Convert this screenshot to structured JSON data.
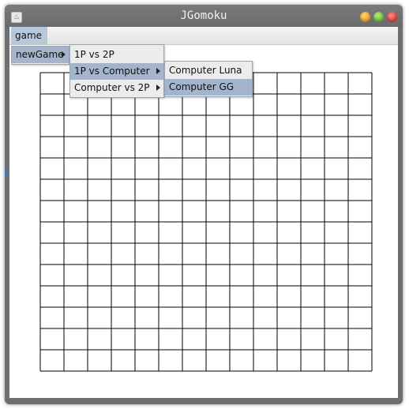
{
  "window": {
    "title": "JGomoku",
    "app_icon_glyph": "♨"
  },
  "menubar": {
    "game_label": "game"
  },
  "game_menu": {
    "items": [
      {
        "label": "newGame",
        "has_submenu": true,
        "selected": true
      }
    ]
  },
  "newgame_menu": {
    "items": [
      {
        "label": "1P vs 2P",
        "has_submenu": false,
        "selected": false
      },
      {
        "label": "1P vs Computer",
        "has_submenu": true,
        "selected": true
      },
      {
        "label": "Computer vs 2P",
        "has_submenu": true,
        "selected": false
      }
    ]
  },
  "computer_menu": {
    "items": [
      {
        "label": "Computer Luna",
        "selected": false
      },
      {
        "label": "Computer GG",
        "selected": true
      }
    ]
  },
  "board": {
    "rows": 14,
    "cols": 14,
    "line_color": "#000000"
  },
  "colors": {
    "selected_menu": "#a4b4ca",
    "menu_bg": "#ececec"
  }
}
